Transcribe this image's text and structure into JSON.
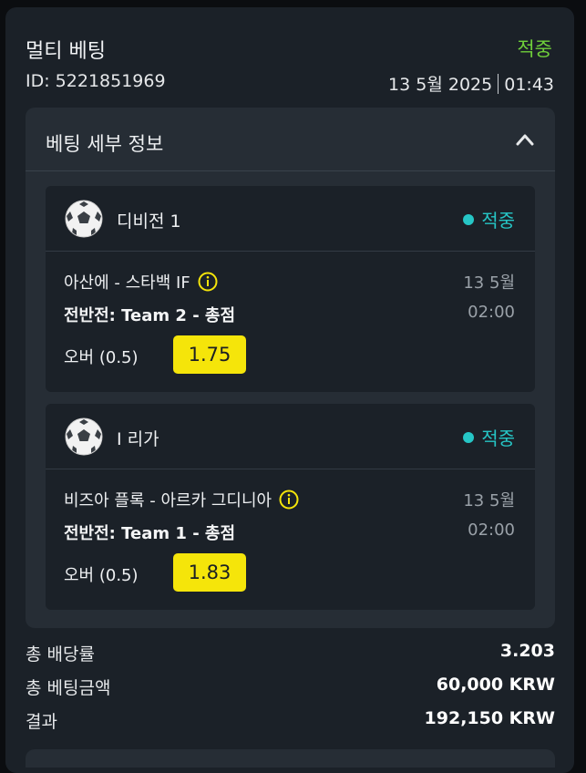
{
  "header": {
    "title": "멀티 베팅",
    "status": "적중",
    "id_text": "ID: 5221851969",
    "date": "13 5월 2025",
    "time": "01:43"
  },
  "details": {
    "title": "베팅 세부 정보",
    "toggle_icon": "chevron-up-icon"
  },
  "legs": [
    {
      "sport_icon": "soccer-ball-icon",
      "league": "디비전 1",
      "result": "적중",
      "match": "아산에 - 스타백 IF",
      "match_date": "13 5월",
      "market": "전반전: Team 2 - 총점",
      "match_time": "02:00",
      "pick": "오버 (0.5)",
      "odds": "1.75"
    },
    {
      "sport_icon": "soccer-ball-icon",
      "league": "I 리가",
      "result": "적중",
      "match": "비즈아 플록 - 아르카 그디니아",
      "match_date": "13 5월",
      "market": "전반전: Team 1 - 총점",
      "match_time": "02:00",
      "pick": "오버 (0.5)",
      "odds": "1.83"
    }
  ],
  "summary": {
    "total_odds_label": "총 배당률",
    "total_odds_value": "3.203",
    "total_stake_label": "총 베팅금액",
    "total_stake_value": "60,000 KRW",
    "result_label": "결과",
    "result_value": "192,150 KRW"
  },
  "colors": {
    "win_green": "#6fcf3a",
    "win_teal": "#26c6c6",
    "odds_yellow": "#f5e50a"
  }
}
